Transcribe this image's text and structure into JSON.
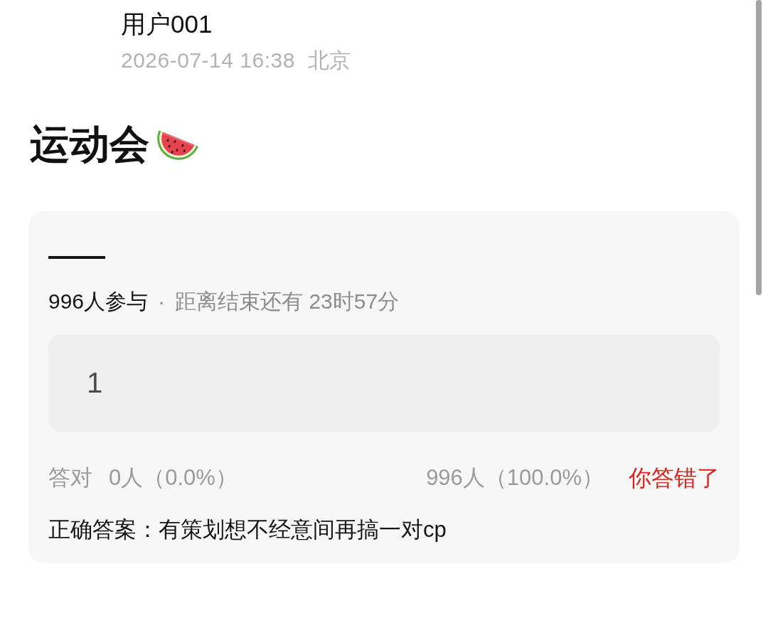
{
  "post": {
    "author": "用户001",
    "timestamp": "2026-07-14 16:38",
    "location": "北京",
    "title": "运动会"
  },
  "quiz": {
    "question": "——",
    "participants": "996人参与",
    "separator": "·",
    "countdown": "距离结束还有 23时57分",
    "options": [
      {
        "label": "1"
      }
    ],
    "stats": {
      "correct_label": "答对",
      "correct_count": "0人（0.0%）",
      "wrong_count": "996人（100.0%）",
      "result": "你答错了",
      "is_correct": false
    },
    "correct_answer": "正确答案：有策划想不经意间再搞一对cp"
  }
}
